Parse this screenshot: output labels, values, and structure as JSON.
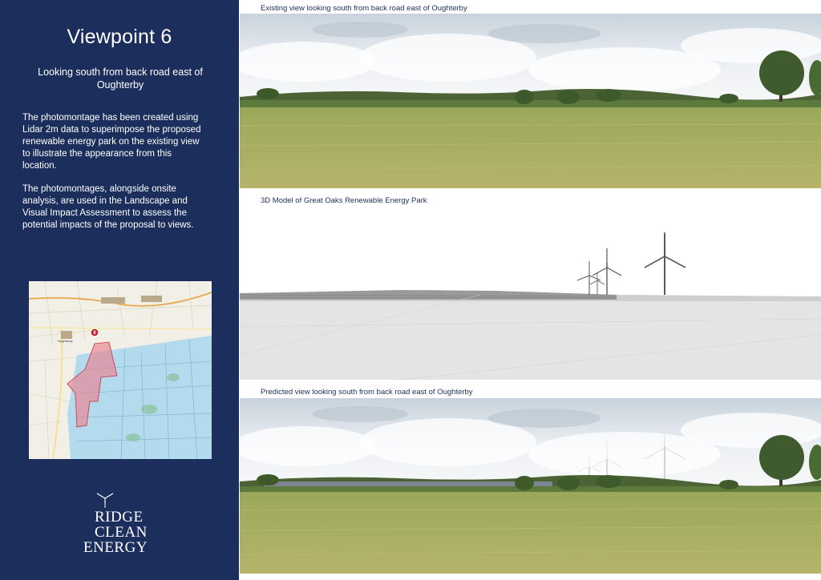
{
  "sidebar": {
    "title": "Viewpoint 6",
    "subtitle": "Looking south from back road east of Oughterby",
    "paragraph_1": "The photomontage has been created using Lidar 2m data to superimpose the proposed renewable energy park on the existing view to illustrate the appearance from this location.",
    "paragraph_2": "The photomontages, alongside onsite analysis, are used in the Landscape and Visual Impact Assessment to assess the potential impacts of the proposal to views.",
    "map": {
      "marker_label": "6",
      "place_label": "Oughterby",
      "colors": {
        "study_area": "#9fd3ef",
        "site_boundary": "#e05a6a",
        "marker": "#c0262d"
      }
    },
    "logo": {
      "line_1": "RIDGE",
      "line_2": "CLEAN",
      "line_3": "ENERGY",
      "icon": "turbine-icon"
    }
  },
  "panels": [
    {
      "caption": "Existing view looking south from back road east of Oughterby"
    },
    {
      "caption": "3D Model of Great Oaks Renewable Energy Park"
    },
    {
      "caption": "Predicted view looking south from back road east of Oughterby"
    }
  ],
  "colors": {
    "navy": "#1c2f5c",
    "grass": "#a9b45c",
    "sky": "#dfe6ee"
  }
}
